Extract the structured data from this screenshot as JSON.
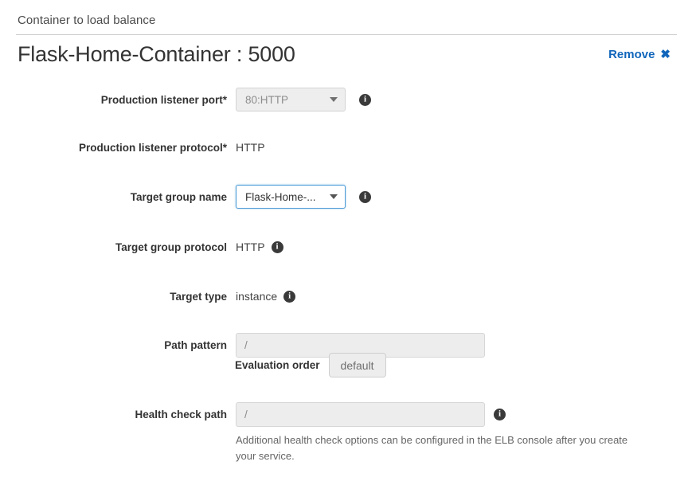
{
  "section": {
    "label": "Container to load balance",
    "title": "Flask-Home-Container : 5000",
    "remove_label": "Remove",
    "remove_icon": "close-x-icon"
  },
  "fields": {
    "production_listener_port": {
      "label": "Production listener port*",
      "value": "80:HTTP",
      "state": "disabled",
      "info_icon": "info-icon",
      "caret_icon": "chevron-down-icon"
    },
    "production_listener_protocol": {
      "label": "Production listener protocol*",
      "value": "HTTP"
    },
    "target_group_name": {
      "label": "Target group name",
      "value": "Flask-Home-...",
      "state": "focused",
      "info_icon": "info-icon",
      "caret_icon": "chevron-down-icon"
    },
    "target_group_protocol": {
      "label": "Target group protocol",
      "value": "HTTP",
      "info_icon": "info-icon"
    },
    "target_type": {
      "label": "Target type",
      "value": "instance",
      "info_icon": "info-icon"
    },
    "path_pattern": {
      "label": "Path pattern",
      "value": "/",
      "state": "disabled"
    },
    "evaluation_order": {
      "label": "Evaluation order",
      "value": "default"
    },
    "health_check_path": {
      "label": "Health check path",
      "value": "/",
      "state": "disabled",
      "info_icon": "info-icon",
      "help": "Additional health check options can be configured in the ELB console after you create your service."
    }
  },
  "colors": {
    "link": "#1166bb",
    "focus_border": "#4c9bd6",
    "text": "#333333",
    "muted": "#8a8a8a",
    "divider": "#cfcfcf"
  }
}
